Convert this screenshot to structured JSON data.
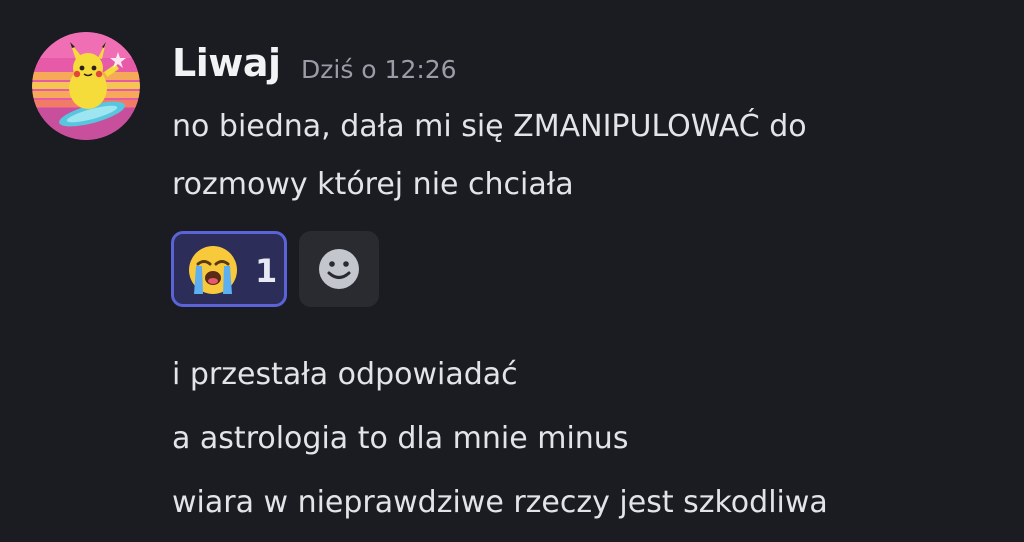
{
  "message": {
    "author": "Liwaj",
    "timestamp": "Dziś o 12:26",
    "lines": [
      "no biedna, dała mi się ZMANIPULOWAĆ do",
      "rozmowy której nie chciała"
    ]
  },
  "reactions": [
    {
      "emoji": "loudly-crying-face-icon",
      "count": "1",
      "selected": true
    }
  ],
  "add_reaction": {
    "icon": "smiley-add-reaction-icon"
  },
  "followups": [
    "i przestała odpowiadać",
    "a astrologia to dla mnie minus",
    "wiara w nieprawdziwe rzeczy jest szkodliwa"
  ],
  "colors": {
    "background": "#1b1c21",
    "reaction_selected_bg": "#2c2d58",
    "reaction_selected_border": "#5a63d8",
    "timestamp": "#9a9ca6"
  }
}
